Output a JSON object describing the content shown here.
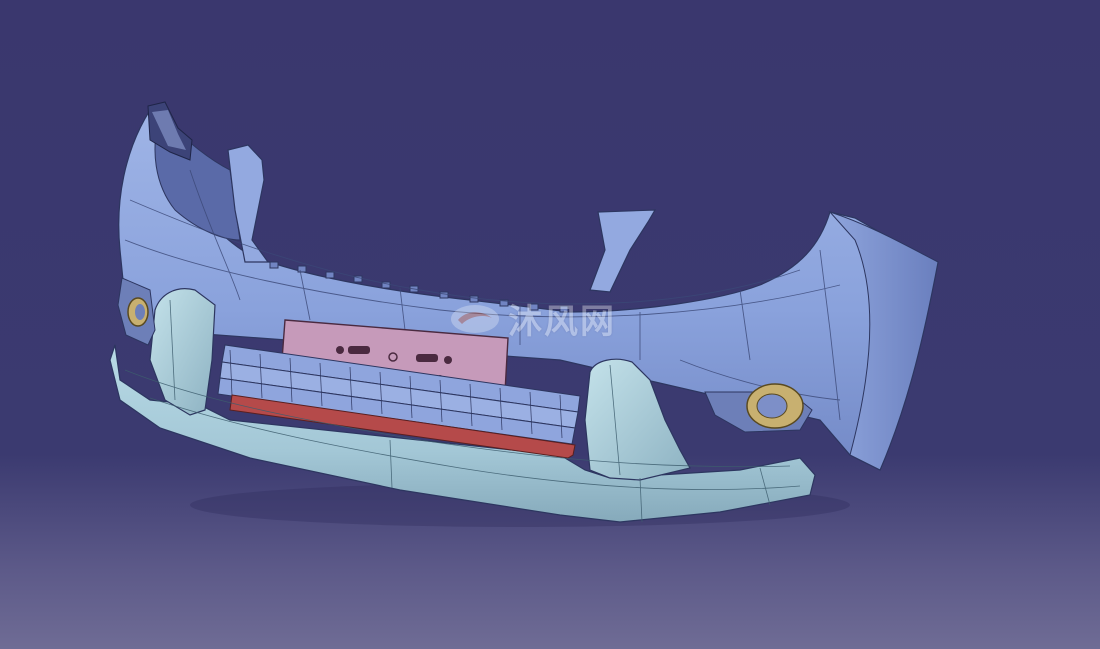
{
  "viewport": {
    "background_top": "#3a376e",
    "background_bottom": "#6f6c95"
  },
  "model": {
    "part": "front-bumper",
    "surface_colors": {
      "upper_fascia": "#8aa2dc",
      "upper_fascia_shade": "#6a80c0",
      "lower_valance": "#a3c7d6",
      "lower_valance_shade": "#7fa3b4",
      "plate": "#c69aba",
      "grille_stripe": "#b54a4a",
      "fog_lamp": "#c8b070"
    }
  },
  "watermark": {
    "text": "沐风网",
    "icon": "wind-logo-icon"
  }
}
